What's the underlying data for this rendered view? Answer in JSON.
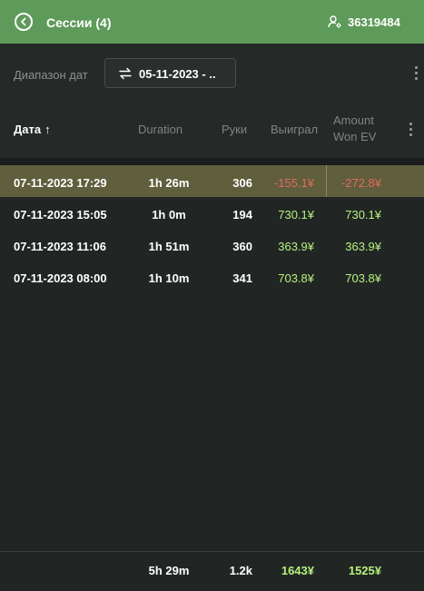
{
  "header": {
    "title": "Сессии (4)",
    "user_id": "36319484",
    "back_icon": "back-arrow-circle-icon",
    "user_icon": "user-settings-icon",
    "bg_color": "#5e9a5a"
  },
  "filter": {
    "range_label": "Диапазон дат",
    "date_range_value": "05-11-2023 - ..",
    "swap_icon": "swap-arrows-icon"
  },
  "columns": {
    "date": "Дата",
    "date_sort": "↑",
    "duration": "Duration",
    "hands": "Руки",
    "won": "Выиграл",
    "amount_ev_line1": "Amount",
    "amount_ev_line2": "Won EV"
  },
  "rows": [
    {
      "date": "07-11-2023 17:29",
      "duration": "1h 26m",
      "hands": "306",
      "won": "-155.1¥",
      "won_ev": "-272.8¥",
      "selected": true
    },
    {
      "date": "07-11-2023 15:05",
      "duration": "1h 0m",
      "hands": "194",
      "won": "730.1¥",
      "won_ev": "730.1¥",
      "selected": false
    },
    {
      "date": "07-11-2023 11:06",
      "duration": "1h 51m",
      "hands": "360",
      "won": "363.9¥",
      "won_ev": "363.9¥",
      "selected": false
    },
    {
      "date": "07-11-2023 08:00",
      "duration": "1h 10m",
      "hands": "341",
      "won": "703.8¥",
      "won_ev": "703.8¥",
      "selected": false
    }
  ],
  "totals": {
    "duration": "5h 29m",
    "hands": "1.2k",
    "won": "1643¥",
    "won_ev": "1525¥"
  },
  "colors": {
    "negative": "#e56a5a",
    "positive": "#b6f07d",
    "selected_row": "#5f5e3d"
  }
}
